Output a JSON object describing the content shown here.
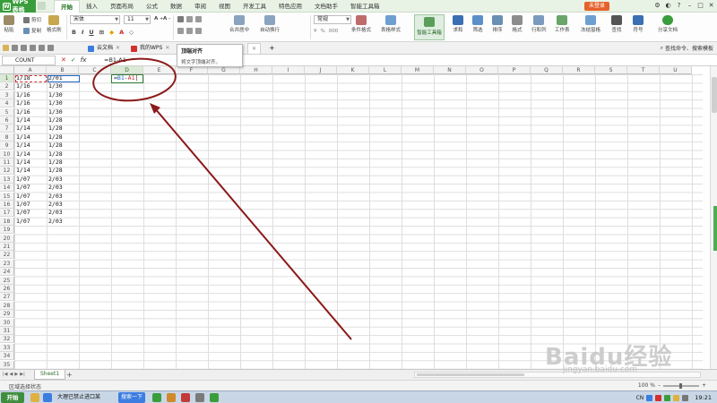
{
  "app": {
    "name": "WPS 表格",
    "menu": [
      "开始",
      "插入",
      "页面布局",
      "公式",
      "数据",
      "审阅",
      "视图",
      "开发工具",
      "特色应用",
      "文档助手",
      "智能工具箱"
    ],
    "active_menu": "开始",
    "login_label": "未登录"
  },
  "ribbon": {
    "paste": "粘贴",
    "cut": "剪切",
    "copy": "复制",
    "format_painter": "格式刷",
    "font_name": "宋体",
    "font_size": "11",
    "merge_center": "合并居中",
    "wrap_text": "自动换行",
    "number_format": "常规",
    "conditional_format": "条件格式",
    "table_style": "表格样式",
    "smart_toolbox": "智能工具箱",
    "sum": "求和",
    "filter": "筛选",
    "sort": "排序",
    "format": "格式",
    "row_col": "行和列",
    "worksheet": "工作表",
    "freeze": "冻结窗格",
    "find": "查找",
    "symbol": "符号",
    "share": "分享文档"
  },
  "tabs": [
    {
      "label": "云文档",
      "icon": "cloud-icon"
    },
    {
      "label": "我的WPS",
      "icon": "wps-icon"
    }
  ],
  "tooltip": {
    "title": "顶端对齐",
    "body": "将文字顶端对齐。"
  },
  "search_cmd": "查找命令、搜索模板",
  "formula_bar": {
    "name_box": "COUNT",
    "formula": "=B1-A1",
    "cancel": "✕",
    "confirm": "✓",
    "fx": "fx"
  },
  "columns": [
    "A",
    "B",
    "C",
    "D",
    "E",
    "F",
    "G",
    "H",
    "I",
    "J",
    "K",
    "L",
    "M",
    "N",
    "O",
    "P",
    "Q",
    "R",
    "S",
    "T",
    "U"
  ],
  "rows": [
    "1",
    "2",
    "3",
    "4",
    "5",
    "6",
    "7",
    "8",
    "9",
    "10",
    "11",
    "12",
    "13",
    "14",
    "15",
    "16",
    "17",
    "18",
    "19",
    "20",
    "21",
    "22",
    "23",
    "24",
    "25",
    "26",
    "27",
    "28",
    "29",
    "30",
    "31",
    "32",
    "33",
    "34",
    "35"
  ],
  "cells": {
    "A": [
      "1/18",
      "1/16",
      "1/16",
      "1/16",
      "1/16",
      "1/14",
      "1/14",
      "1/14",
      "1/14",
      "1/14",
      "1/14",
      "1/14",
      "1/07",
      "1/07",
      "1/07",
      "1/07",
      "1/07",
      "1/07"
    ],
    "B": [
      "2/01",
      "1/30",
      "1/30",
      "1/30",
      "1/30",
      "1/28",
      "1/28",
      "1/28",
      "1/28",
      "1/28",
      "1/28",
      "1/28",
      "2/03",
      "2/03",
      "2/03",
      "2/03",
      "2/03",
      "2/03"
    ]
  },
  "editing_cell": {
    "ref": "D1",
    "text_eq": "=",
    "ref1": "B1",
    "minus": "-",
    "ref2": "A1"
  },
  "sheet_tab": "Sheet1",
  "status": {
    "mode": "区域选择状态",
    "zoom": "100 %"
  },
  "taskbar": {
    "start": "开始",
    "window_title": "大理已禁止进口某",
    "search": "搜索一下",
    "time": "19:21",
    "lang": "CN"
  },
  "watermark": {
    "text": "Baidu经验",
    "url": "jingyan.baidu.com"
  },
  "colors": {
    "brand_green": "#3a9d3c",
    "annotation_red": "#8b1a1a",
    "b1_ref": "#1e63c6",
    "a1_ref": "#d32f2f"
  }
}
